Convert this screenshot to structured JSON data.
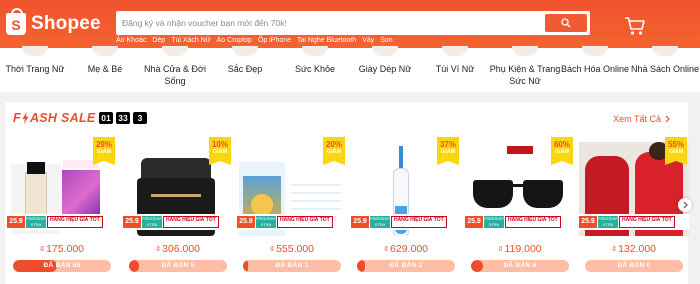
{
  "header": {
    "logo_mark": "S",
    "logo_text": "Shopee",
    "search_placeholder": "Đăng ký và nhận voucher bạn mới đến 70k!",
    "keywords": [
      "Áo Khoác",
      "Dép",
      "Túi Xách Nữ",
      "Áo Croptop",
      "Ốp iPhone",
      "Tai Nghe Bluetooth",
      "Váy",
      "Son"
    ]
  },
  "categories": [
    "Thời Trang Nữ",
    "Mẹ & Bé",
    "Nhà Cửa & Đời Sống",
    "Sắc Đẹp",
    "Sức Khỏe",
    "Giày Dép Nữ",
    "Túi Ví Nữ",
    "Phụ Kiện & Trang Sức Nữ",
    "Bách Hóa Online",
    "Nhà Sách Online"
  ],
  "flash_sale": {
    "title_left": "F",
    "title_right": "ASH SALE",
    "timer": [
      "01",
      "33",
      "3"
    ],
    "see_all": "Xem Tất Cả",
    "products": [
      {
        "discount": "29%",
        "discount_label": "GIẢM",
        "price": "175.000",
        "sold": "ĐÃ BÁN 58",
        "sold_ratio": 0.45,
        "name": "maybelline-foundation"
      },
      {
        "discount": "10%",
        "discount_label": "GIẢM",
        "price": "306.000",
        "sold": "ĐÃ BÁN 5",
        "sold_ratio": 0.1,
        "name": "innisfree-mask"
      },
      {
        "discount": "20%",
        "discount_label": "GIẢM",
        "price": "555.000",
        "sold": "ĐÃ BÁN 1",
        "sold_ratio": 0.05,
        "name": "dhc-supplement"
      },
      {
        "discount": "37%",
        "discount_label": "GIẢM",
        "price": "629.000",
        "sold": "ĐÃ BÁN 2",
        "sold_ratio": 0.08,
        "name": "water-flosser"
      },
      {
        "discount": "60%",
        "discount_label": "GIẢM",
        "price": "119.000",
        "sold": "ĐÃ BÁN 6",
        "sold_ratio": 0.12,
        "name": "sunglasses"
      },
      {
        "discount": "55%",
        "discount_label": "GIẢM",
        "price": "132.000",
        "sold": "ĐÃ BÁN 0",
        "sold_ratio": 0.0,
        "name": "red-shirt"
      }
    ],
    "banner_day": "25.9",
    "banner_tag1": "FREESHIP XTRA",
    "banner_tag2": "HÀNG HIỆU GIÁ TỐT",
    "currency": "₫"
  },
  "colors": {
    "brand": "#ee4d2d",
    "badge": "#fcd511"
  }
}
